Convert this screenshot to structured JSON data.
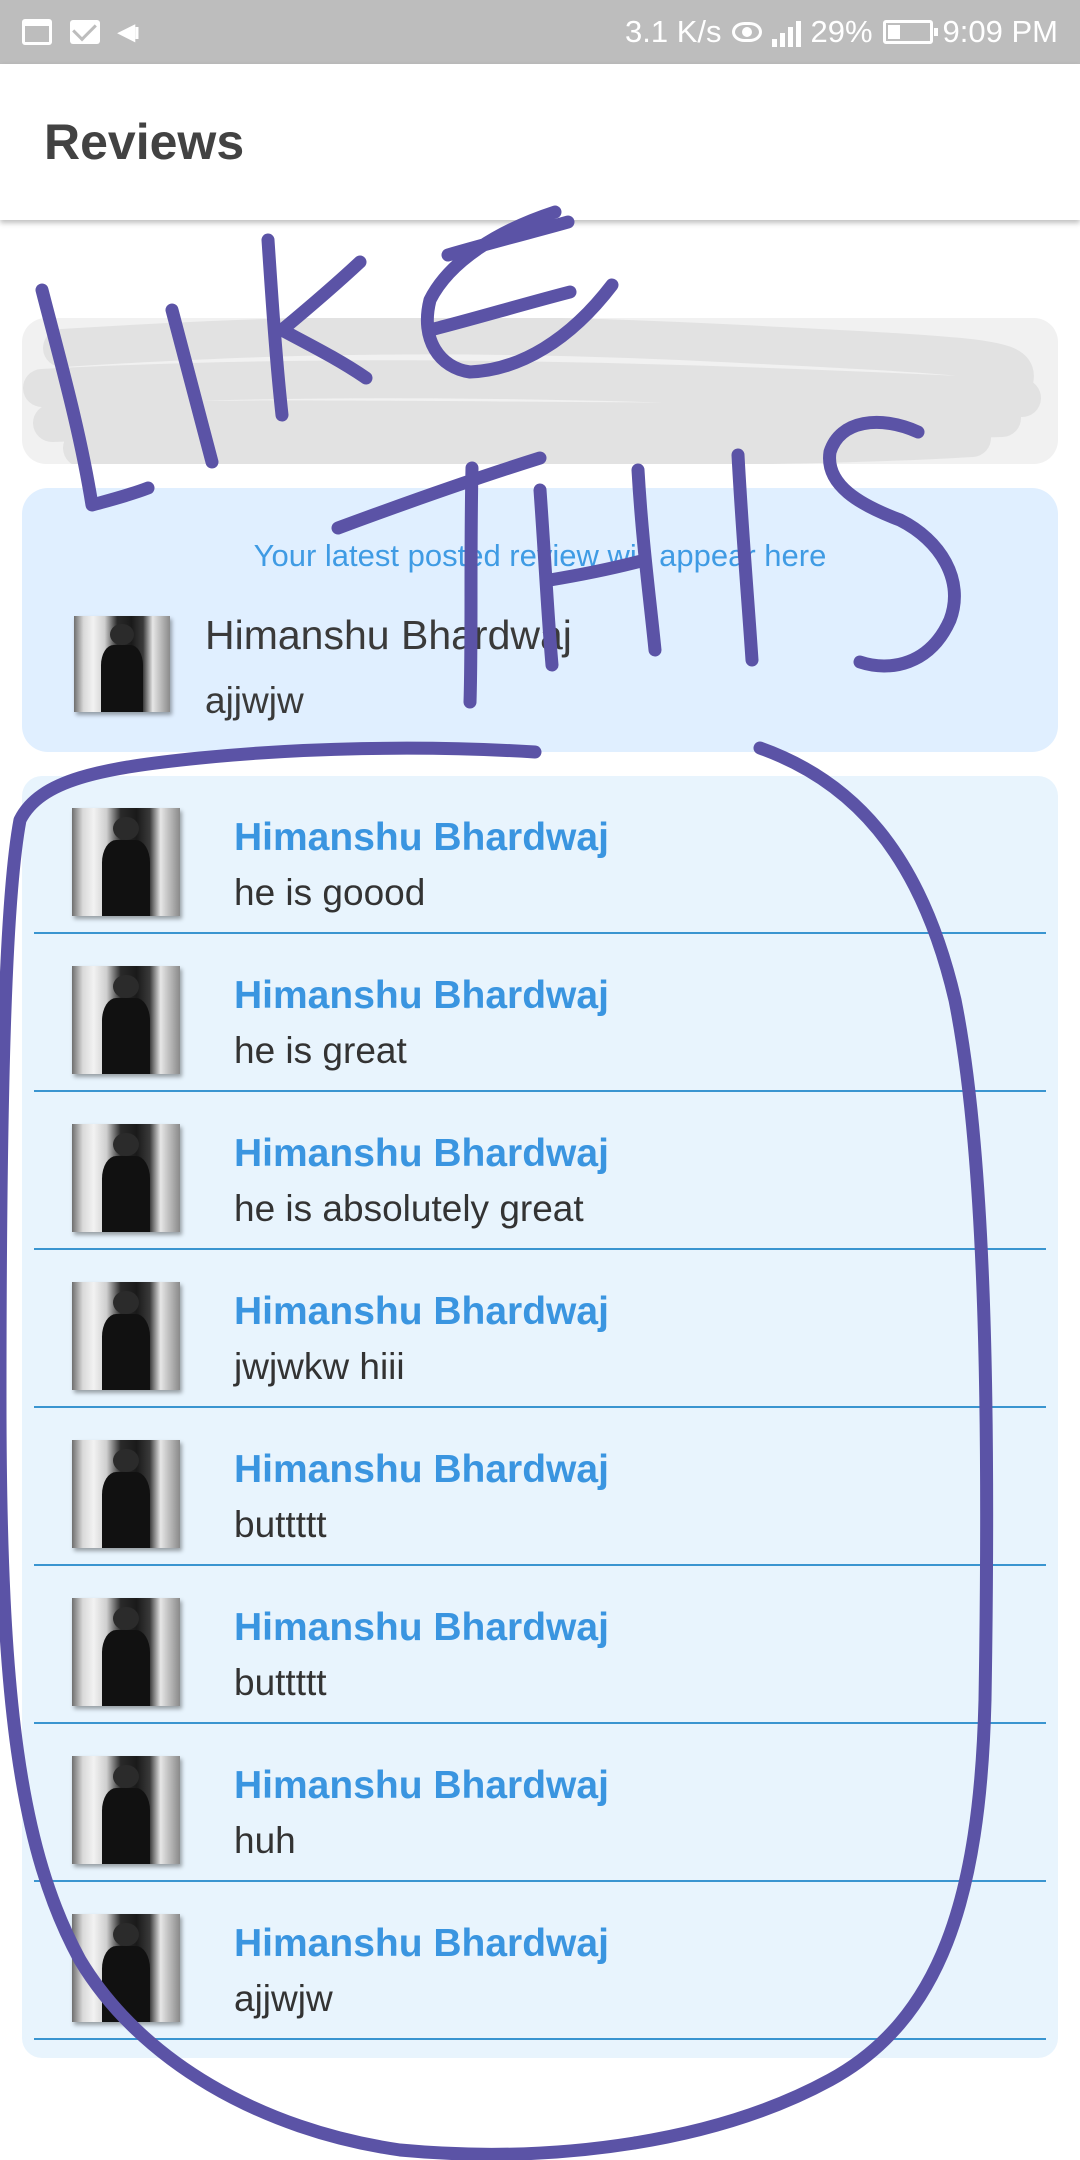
{
  "status_bar": {
    "net_speed": "3.1 K/s",
    "battery_pct": "29%",
    "time": "9:09 PM",
    "icons": [
      "calendar-icon",
      "mail-icon",
      "volte-icon",
      "eye-icon",
      "signal-icon",
      "battery-icon"
    ]
  },
  "app_bar": {
    "title": "Reviews"
  },
  "latest_review": {
    "caption": "Your latest posted review will appear here",
    "name": "Himanshu Bhardwaj",
    "text": "ajjwjw"
  },
  "reviews": [
    {
      "name": "Himanshu Bhardwaj",
      "text": "he is goood"
    },
    {
      "name": "Himanshu Bhardwaj",
      "text": "he is great"
    },
    {
      "name": "Himanshu Bhardwaj",
      "text": "he is absolutely great"
    },
    {
      "name": "Himanshu Bhardwaj",
      "text": "jwjwkw hiii"
    },
    {
      "name": "Himanshu Bhardwaj",
      "text": "buttttt"
    },
    {
      "name": "Himanshu Bhardwaj",
      "text": "buttttt"
    },
    {
      "name": "Himanshu Bhardwaj",
      "text": "huh"
    },
    {
      "name": "Himanshu Bhardwaj",
      "text": "ajjwjw"
    }
  ],
  "annotation": {
    "handwriting": "LIKE THIS",
    "marker_color": "#5b53a6"
  },
  "colors": {
    "accent_name": "#3a95e0",
    "latest_card_bg": "#e0efff",
    "list_bg": "#e8f4fd",
    "status_bar_bg": "#bdbdbd"
  }
}
